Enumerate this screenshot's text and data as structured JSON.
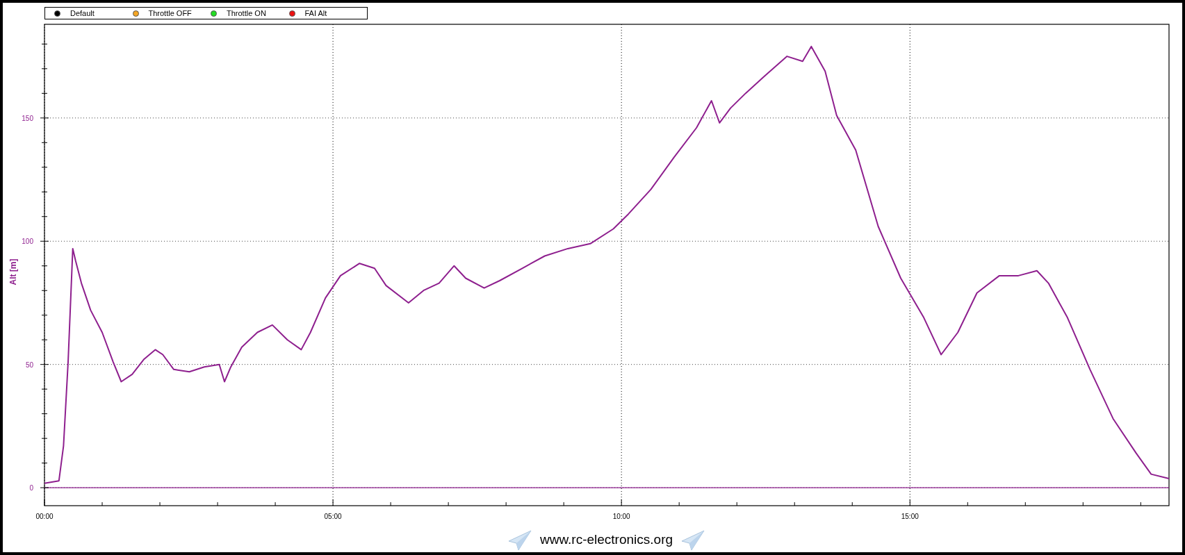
{
  "legend": [
    {
      "label": "Default",
      "color": "#000000"
    },
    {
      "label": "Throttle OFF",
      "color": "#f5a623"
    },
    {
      "label": "Throttle ON",
      "color": "#22dd22"
    },
    {
      "label": "FAI Alt",
      "color": "#ee1111"
    }
  ],
  "chart": {
    "chart_data": {
      "type": "line",
      "ylabel": "Alt [m]",
      "xlim": [
        0,
        19.49
      ],
      "ylim": [
        -7.3,
        188
      ],
      "xticks": [
        {
          "value": 0,
          "label": "00:00"
        },
        {
          "value": 5,
          "label": "05:00"
        },
        {
          "value": 10,
          "label": "10:00"
        },
        {
          "value": 15,
          "label": "15:00"
        }
      ],
      "yticks": [
        0,
        50,
        100,
        150
      ],
      "grid": true,
      "ref_lines": [
        {
          "axis": "y",
          "value": 0,
          "color": "#8e1f8e"
        }
      ],
      "x": [
        0,
        0.25,
        0.33,
        0.41,
        0.49,
        0.54,
        0.64,
        0.8,
        1.0,
        1.19,
        1.33,
        1.52,
        1.72,
        1.92,
        2.05,
        2.24,
        2.51,
        2.77,
        3.03,
        3.12,
        3.23,
        3.42,
        3.69,
        3.95,
        4.21,
        4.45,
        4.61,
        4.87,
        5.13,
        5.46,
        5.72,
        5.92,
        6.31,
        6.57,
        6.84,
        7.1,
        7.3,
        7.62,
        7.89,
        8.28,
        8.67,
        9.07,
        9.46,
        9.86,
        10.12,
        10.51,
        10.91,
        11.3,
        11.56,
        11.7,
        11.89,
        12.15,
        12.48,
        12.87,
        13.14,
        13.29,
        13.53,
        13.73,
        14.06,
        14.45,
        14.84,
        15.24,
        15.54,
        15.83,
        16.16,
        16.55,
        16.88,
        17.2,
        17.4,
        17.73,
        18.12,
        18.52,
        18.92,
        19.18,
        19.49
      ],
      "series": [
        {
          "color": "#8e1f8e",
          "values": [
            1.8,
            2.8,
            17,
            51,
            97,
            92,
            83,
            72,
            63,
            51,
            43,
            46,
            52,
            56,
            54,
            48,
            47,
            49,
            50,
            43,
            49,
            57,
            63,
            66,
            60,
            56,
            63,
            77,
            86,
            91,
            89,
            82,
            75,
            80,
            83,
            90,
            85,
            81,
            84,
            89,
            94,
            97,
            99,
            105,
            111,
            121,
            134,
            146,
            157,
            148,
            154,
            160,
            167,
            175,
            173,
            179,
            169,
            151,
            137,
            106,
            85,
            69,
            54,
            63,
            79,
            86,
            86,
            88,
            83,
            69,
            48,
            28,
            14,
            5.5,
            3.7
          ]
        }
      ]
    }
  },
  "footer": {
    "text": "www.rc-electronics.org"
  }
}
